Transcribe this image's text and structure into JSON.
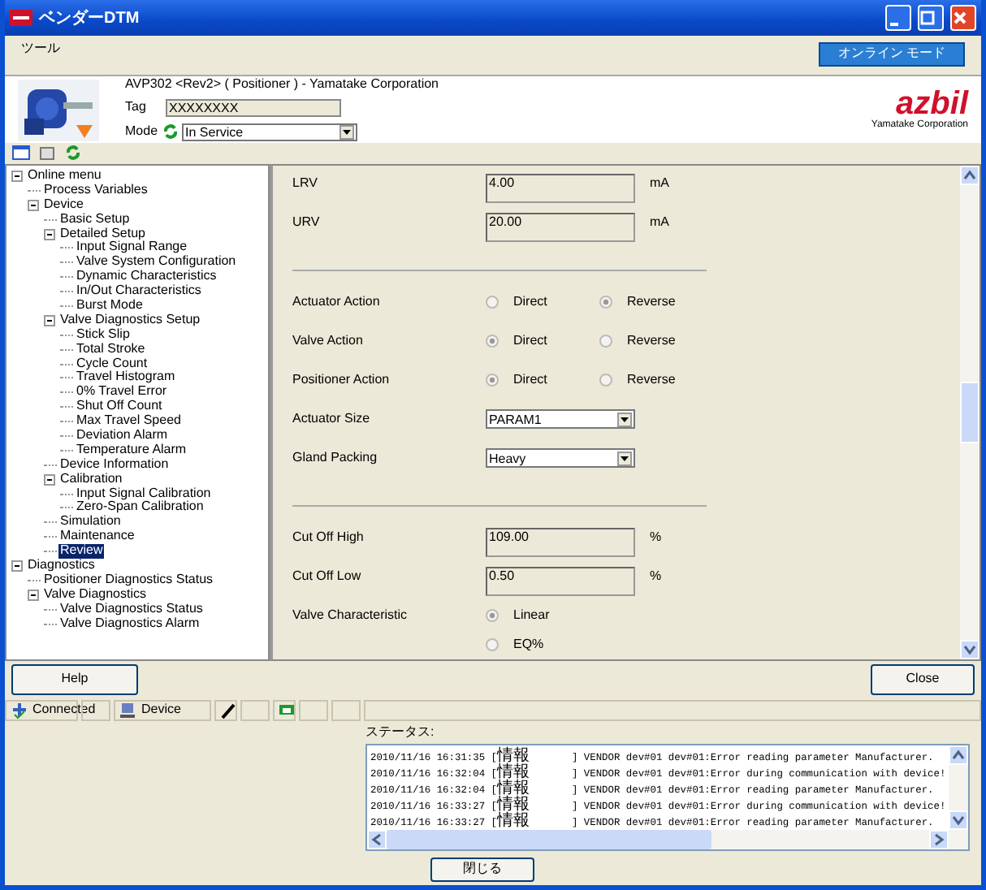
{
  "window": {
    "title": "ベンダーDTM"
  },
  "menu": [
    {
      "label": "ツール"
    }
  ],
  "mode_button": "オンライン モード",
  "header": {
    "device_title": "AVP302 <Rev2> ( Positioner ) - Yamatake Corporation",
    "tag_label": "Tag",
    "tag_value": "XXXXXXXX",
    "mode_label": "Mode",
    "mode_value": "In Service",
    "logo": "azbil",
    "logo_sub": "Yamatake Corporation"
  },
  "tree": [
    {
      "label": "Online menu",
      "selected": false,
      "expanded": true,
      "children": [
        {
          "label": "Process Variables",
          "selected": false
        },
        {
          "label": "Device",
          "selected": false,
          "expanded": true,
          "children": [
            {
              "label": "Basic Setup",
              "selected": false
            },
            {
              "label": "Detailed Setup",
              "selected": false,
              "expanded": true,
              "children": [
                {
                  "label": "Input Signal Range",
                  "selected": false
                },
                {
                  "label": "Valve System Configuration",
                  "selected": false
                },
                {
                  "label": "Dynamic Characteristics",
                  "selected": false
                },
                {
                  "label": "In/Out Characteristics",
                  "selected": false
                },
                {
                  "label": "Burst Mode",
                  "selected": false
                }
              ]
            },
            {
              "label": "Valve Diagnostics Setup",
              "selected": false,
              "expanded": true,
              "children": [
                {
                  "label": "Stick Slip",
                  "selected": false
                },
                {
                  "label": "Total Stroke",
                  "selected": false
                },
                {
                  "label": "Cycle Count",
                  "selected": false
                },
                {
                  "label": "Travel Histogram",
                  "selected": false
                },
                {
                  "label": "0% Travel Error",
                  "selected": false
                },
                {
                  "label": "Shut Off Count",
                  "selected": false
                },
                {
                  "label": "Max Travel Speed",
                  "selected": false
                },
                {
                  "label": "Deviation Alarm",
                  "selected": false
                },
                {
                  "label": "Temperature Alarm",
                  "selected": false
                }
              ]
            },
            {
              "label": "Device Information",
              "selected": false
            },
            {
              "label": "Calibration",
              "selected": false,
              "expanded": true,
              "children": [
                {
                  "label": "Input Signal Calibration",
                  "selected": false
                },
                {
                  "label": "Zero-Span Calibration",
                  "selected": false
                }
              ]
            },
            {
              "label": "Simulation",
              "selected": false
            },
            {
              "label": "Maintenance",
              "selected": false
            },
            {
              "label": "Review",
              "selected": true
            }
          ]
        }
      ]
    },
    {
      "label": "Diagnostics",
      "selected": false,
      "expanded": true,
      "children": [
        {
          "label": "Positioner Diagnostics Status",
          "selected": false
        },
        {
          "label": "Valve Diagnostics",
          "selected": false,
          "expanded": true,
          "children": [
            {
              "label": "Valve Diagnostics Status",
              "selected": false
            },
            {
              "label": "Valve Diagnostics Alarm",
              "selected": false
            }
          ]
        }
      ]
    }
  ],
  "content": [
    {
      "kind": "field",
      "label": "LRV",
      "value": "4.00",
      "unit": "mA"
    },
    {
      "kind": "field",
      "label": "URV",
      "value": "20.00",
      "unit": "mA"
    },
    {
      "kind": "divider"
    },
    {
      "kind": "radio",
      "label": "Actuator Action",
      "options": [
        {
          "label": "Direct",
          "selected": false
        },
        {
          "label": "Reverse",
          "selected": true
        }
      ]
    },
    {
      "kind": "radio",
      "label": "Valve Action",
      "options": [
        {
          "label": "Direct",
          "selected": true
        },
        {
          "label": "Reverse",
          "selected": false
        }
      ]
    },
    {
      "kind": "radio",
      "label": "Positioner Action",
      "options": [
        {
          "label": "Direct",
          "selected": true
        },
        {
          "label": "Reverse",
          "selected": false
        }
      ]
    },
    {
      "kind": "select",
      "label": "Actuator Size",
      "value": "PARAM1"
    },
    {
      "kind": "select",
      "label": "Gland Packing",
      "value": "Heavy"
    },
    {
      "kind": "divider"
    },
    {
      "kind": "field",
      "label": "Cut Off High",
      "value": "109.00",
      "unit": "%"
    },
    {
      "kind": "field",
      "label": "Cut Off Low",
      "value": "0.50",
      "unit": "%"
    },
    {
      "kind": "radio_stack",
      "label": "Valve Characteristic",
      "options": [
        {
          "label": "Linear",
          "selected": true
        },
        {
          "label": "EQ%",
          "selected": false
        }
      ]
    }
  ],
  "buttons": {
    "help": "Help",
    "close": "Close"
  },
  "status_bar": [
    {
      "kind": "connection",
      "text": "Connected"
    },
    {
      "kind": "empty"
    },
    {
      "kind": "device",
      "text": "Device"
    },
    {
      "kind": "edit"
    },
    {
      "kind": "empty"
    },
    {
      "kind": "network"
    },
    {
      "kind": "empty"
    },
    {
      "kind": "empty"
    },
    {
      "kind": "fill"
    }
  ],
  "status_panel": {
    "label": "ステータス:",
    "close_button": "閉じる",
    "log": [
      "2010/11/16 16:31:35 [情報       ] VENDOR dev#01 dev#01:Error reading parameter Manufacturer.",
      "2010/11/16 16:32:04 [情報       ] VENDOR dev#01 dev#01:Error during communication with device!",
      "2010/11/16 16:32:04 [情報       ] VENDOR dev#01 dev#01:Error reading parameter Manufacturer.",
      "2010/11/16 16:33:27 [情報       ] VENDOR dev#01 dev#01:Error during communication with device!",
      "2010/11/16 16:33:27 [情報       ] VENDOR dev#01 dev#01:Error reading parameter Manufacturer."
    ]
  }
}
